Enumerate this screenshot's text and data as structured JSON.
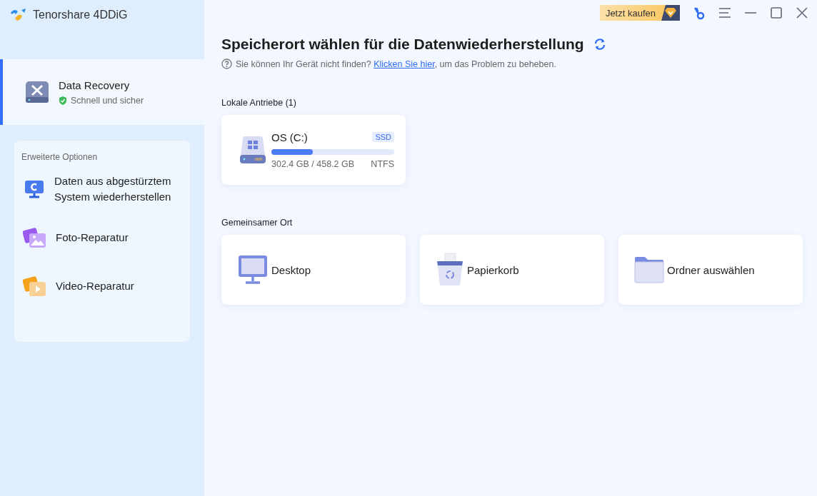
{
  "app": {
    "name": "Tenorshare 4DDiG"
  },
  "sidebar": {
    "main_item": {
      "title": "Data Recovery",
      "subtitle": "Schnell und sicher",
      "selected": true
    },
    "advanced": {
      "heading": "Erweiterte Optionen",
      "items": [
        {
          "kind": "crash",
          "label": "Daten aus abgestürztem System wiederherstellen",
          "selected": false
        },
        {
          "kind": "photo",
          "label": "Foto-Reparatur",
          "selected": false
        },
        {
          "kind": "video",
          "label": "Video-Reparatur",
          "selected": false
        }
      ]
    }
  },
  "title_bar": {
    "buy_button": "Jetzt kaufen"
  },
  "main": {
    "title": "Speicherort wählen für die Datenwiederherstellung",
    "help": {
      "before": "Sie können Ihr Gerät nicht finden? ",
      "link": "Klicken Sie hier",
      "after": ", um das Problem zu beheben."
    },
    "local_heading": "Lokale Antriebe (1)",
    "drives": [
      {
        "name": "OS (C:)",
        "type": "SSD",
        "level": 0.34,
        "usage": "302.4 GB / 458.2 GB",
        "filesystem": "NTFS"
      }
    ],
    "common_heading": "Gemeinsamer Ort",
    "places": [
      {
        "kind": "desktop",
        "label": "Desktop"
      },
      {
        "kind": "trash",
        "label": "Papierkorb"
      },
      {
        "kind": "folder",
        "label": "Ordner auswählen"
      }
    ]
  }
}
